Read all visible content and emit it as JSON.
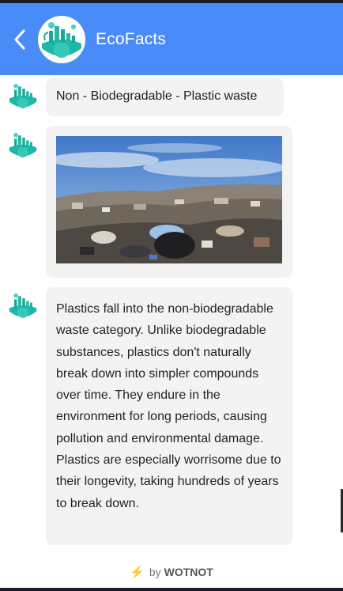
{
  "header": {
    "title": "EcoFacts",
    "background_color": "#4a8cf7",
    "back_icon": "chevron-left-icon",
    "avatar_icon": "eco-city-globe-logo"
  },
  "messages": [
    {
      "type": "text",
      "text": "Non - Biodegradable - Plastic waste"
    },
    {
      "type": "image",
      "subject": "landfill of plastic waste under blue sky"
    },
    {
      "type": "text",
      "text": "Plastics fall into the non-biodegradable waste category. Unlike biodegradable substances, plastics don't naturally break down into simpler compounds over time. They endure in the environment for long periods, causing pollution and environmental damage. Plastics are especially worrisome due to their longevity, taking hundreds of years to break down."
    }
  ],
  "footer": {
    "prefix": "by",
    "brand": "WOTNOT",
    "icon": "lightning-bolt-icon"
  }
}
